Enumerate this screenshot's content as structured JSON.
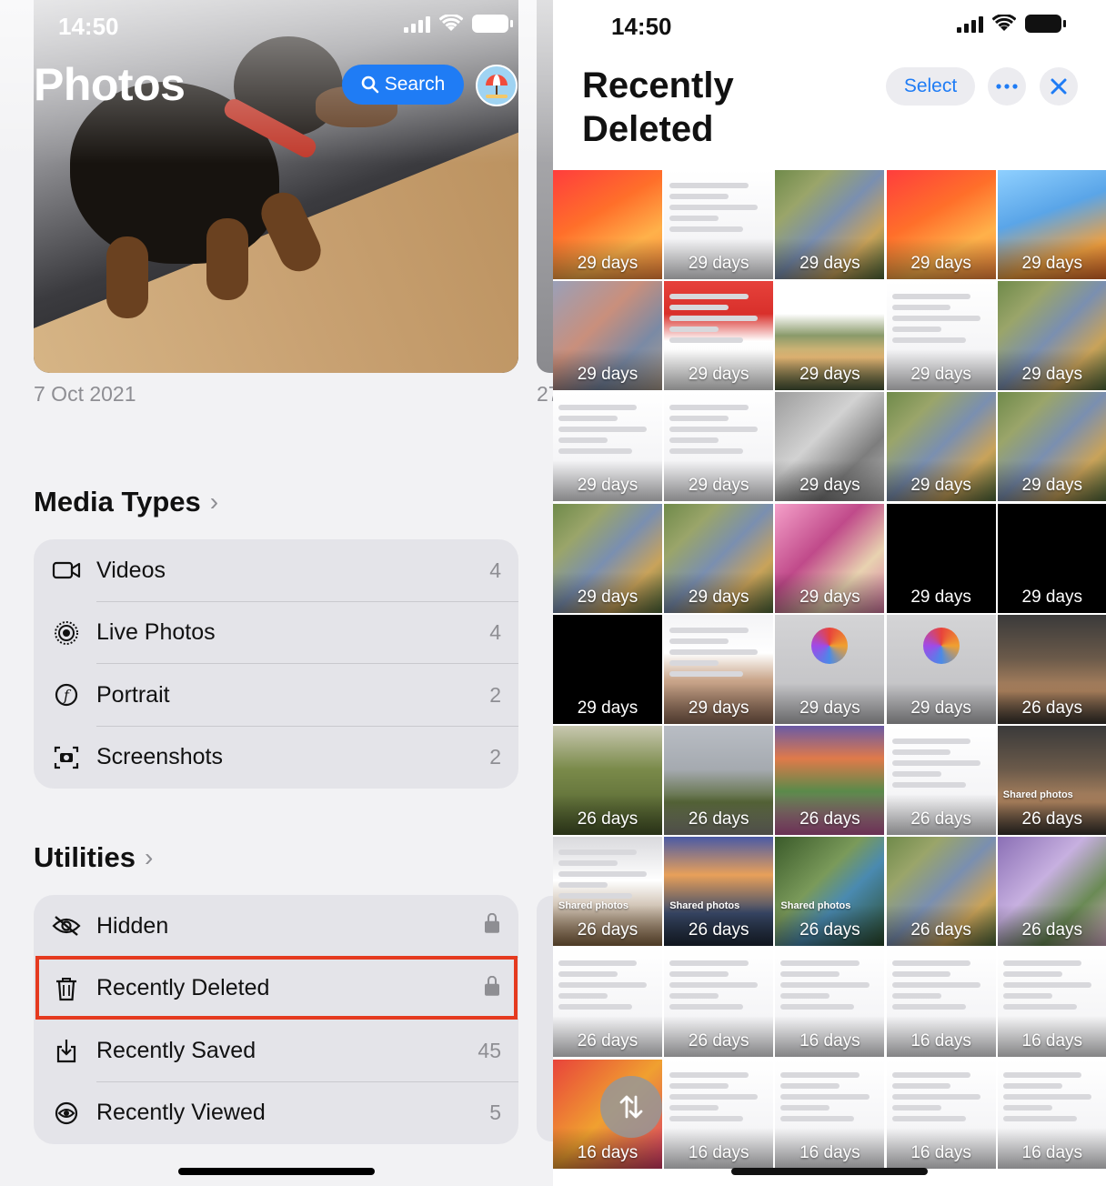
{
  "left": {
    "status": {
      "time": "14:50"
    },
    "title": "Photos",
    "search_label": "Search",
    "hero_date": "7 Oct 2021",
    "hero_date_next": "27",
    "media_types": {
      "title": "Media Types",
      "items": [
        {
          "label": "Videos",
          "count": "4",
          "icon": "video-icon"
        },
        {
          "label": "Live Photos",
          "count": "4",
          "icon": "live-photo-icon"
        },
        {
          "label": "Portrait",
          "count": "2",
          "icon": "portrait-icon"
        },
        {
          "label": "Screenshots",
          "count": "2",
          "icon": "screenshot-icon"
        }
      ]
    },
    "utilities": {
      "title": "Utilities",
      "items": [
        {
          "label": "Hidden",
          "icon": "hidden-eye-icon",
          "locked": true
        },
        {
          "label": "Recently Deleted",
          "icon": "trash-icon",
          "locked": true,
          "highlighted": true
        },
        {
          "label": "Recently Saved",
          "count": "45",
          "icon": "download-icon"
        },
        {
          "label": "Recently Viewed",
          "count": "5",
          "icon": "eye-icon"
        }
      ]
    },
    "highlight_color": "#e53a1f",
    "accent_color": "#1f7cf5"
  },
  "right": {
    "status": {
      "time": "14:50"
    },
    "title_line1": "Recently",
    "title_line2": "Deleted",
    "select_label": "Select",
    "more_icon": "ellipsis-icon",
    "close_icon": "close-icon",
    "sort_icon": "sort-arrows-icon",
    "tiles": [
      {
        "days": "29 days",
        "kind": "wallpaper-orange"
      },
      {
        "days": "29 days",
        "kind": "screenshot"
      },
      {
        "days": "29 days",
        "kind": "collage"
      },
      {
        "days": "29 days",
        "kind": "wallpaper-orange"
      },
      {
        "days": "29 days",
        "kind": "cartoon"
      },
      {
        "days": "29 days",
        "kind": "blur"
      },
      {
        "days": "29 days",
        "kind": "screenshot-red"
      },
      {
        "days": "29 days",
        "kind": "landscape"
      },
      {
        "days": "29 days",
        "kind": "screenshot"
      },
      {
        "days": "29 days",
        "kind": "collage"
      },
      {
        "days": "29 days",
        "kind": "screenshot"
      },
      {
        "days": "29 days",
        "kind": "screenshot"
      },
      {
        "days": "29 days",
        "kind": "collage-gray"
      },
      {
        "days": "29 days",
        "kind": "collage"
      },
      {
        "days": "29 days",
        "kind": "collage"
      },
      {
        "days": "29 days",
        "kind": "collage"
      },
      {
        "days": "29 days",
        "kind": "collage"
      },
      {
        "days": "29 days",
        "kind": "pink"
      },
      {
        "days": "29 days",
        "kind": "black"
      },
      {
        "days": "29 days",
        "kind": "black"
      },
      {
        "days": "29 days",
        "kind": "black"
      },
      {
        "days": "29 days",
        "kind": "screenshot-faces"
      },
      {
        "days": "29 days",
        "kind": "gray-logo"
      },
      {
        "days": "29 days",
        "kind": "gray-logo"
      },
      {
        "days": "26 days",
        "kind": "dog"
      },
      {
        "days": "26 days",
        "kind": "forest"
      },
      {
        "days": "26 days",
        "kind": "road"
      },
      {
        "days": "26 days",
        "kind": "sunset-hills"
      },
      {
        "days": "26 days",
        "kind": "screenshot"
      },
      {
        "days": "26 days",
        "kind": "dog",
        "caption": "Shared photos"
      },
      {
        "days": "26 days",
        "kind": "screenshot-menu",
        "caption": "Shared photos"
      },
      {
        "days": "26 days",
        "kind": "sea-sunset",
        "caption": "Shared photos"
      },
      {
        "days": "26 days",
        "kind": "river",
        "caption": "Shared photos"
      },
      {
        "days": "26 days",
        "kind": "collage"
      },
      {
        "days": "26 days",
        "kind": "collage-purple"
      },
      {
        "days": "26 days",
        "kind": "screenshot"
      },
      {
        "days": "26 days",
        "kind": "screenshot"
      },
      {
        "days": "16 days",
        "kind": "screenshot"
      },
      {
        "days": "16 days",
        "kind": "screenshot"
      },
      {
        "days": "16 days",
        "kind": "widgets"
      },
      {
        "days": "16 days",
        "kind": "widgets-red"
      },
      {
        "days": "16 days",
        "kind": "screenshot"
      },
      {
        "days": "16 days",
        "kind": "screenshot"
      },
      {
        "days": "16 days",
        "kind": "screenshot"
      },
      {
        "days": "16 days",
        "kind": "screenshot"
      }
    ]
  }
}
